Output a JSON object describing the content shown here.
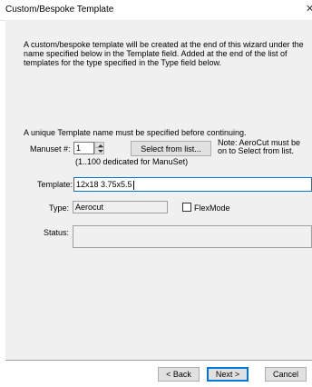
{
  "window": {
    "title": "Custom/Bespoke Template"
  },
  "intro": {
    "text": "A custom/bespoke template will be created at the end of this wizard under the name specified below in the Template field. Added at the end of the list of templates for the type specified in the Type field below."
  },
  "notice": "A unique Template name must be specified before continuing.",
  "manuset": {
    "label": "Manuset #:",
    "value": "1",
    "hint": "(1..100 dedicated for ManuSet)",
    "select_button": "Select from list...",
    "note": "Note: AeroCut must be on to Select from list."
  },
  "template": {
    "label": "Template:",
    "value": "12x18 3.75x5.5"
  },
  "type": {
    "label": "Type:",
    "value": "Aerocut",
    "flexmode_label": "FlexMode",
    "flexmode_checked": false
  },
  "status": {
    "label": "Status:",
    "value": ""
  },
  "buttons": {
    "back": "< Back",
    "next": "Next >",
    "cancel": "Cancel"
  },
  "icons": {
    "close": "close-icon",
    "spin_up": "arrow-up-icon",
    "spin_down": "arrow-down-icon"
  },
  "colors": {
    "dialog_bg": "#f0f0f0",
    "focus_border": "#0078d7"
  }
}
